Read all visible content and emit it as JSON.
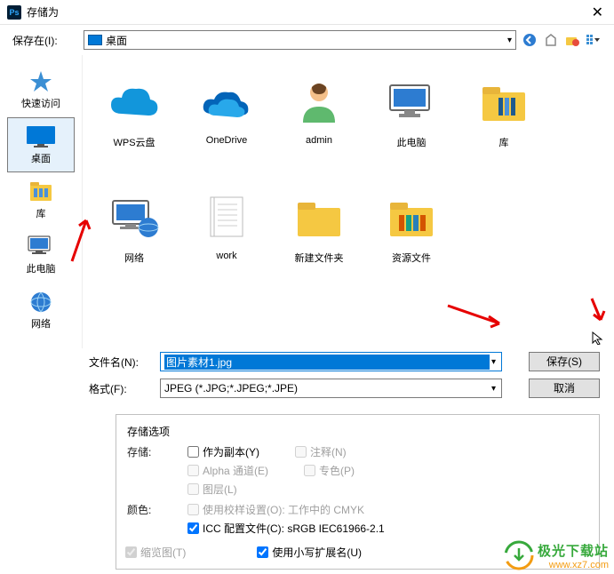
{
  "title": "存储为",
  "toprow": {
    "label": "保存在(I):",
    "location": "桌面"
  },
  "sidebar": [
    {
      "label": "快速访问"
    },
    {
      "label": "桌面"
    },
    {
      "label": "库"
    },
    {
      "label": "此电脑"
    },
    {
      "label": "网络"
    }
  ],
  "files": [
    {
      "label": "WPS云盘"
    },
    {
      "label": "OneDrive"
    },
    {
      "label": "admin"
    },
    {
      "label": "此电脑"
    },
    {
      "label": "库"
    },
    {
      "label": "网络"
    },
    {
      "label": "work"
    },
    {
      "label": "新建文件夹"
    },
    {
      "label": "资源文件"
    }
  ],
  "form": {
    "filename_label": "文件名(N):",
    "filename_value": "图片素材1.jpg",
    "format_label": "格式(F):",
    "format_value": "JPEG (*.JPG;*.JPEG;*.JPE)",
    "save_btn": "保存(S)",
    "cancel_btn": "取消"
  },
  "options": {
    "section": "存储选项",
    "store": "存储:",
    "as_copy": "作为副本(Y)",
    "annotations": "注释(N)",
    "alpha": "Alpha 通道(E)",
    "spot": "专色(P)",
    "layers": "图层(L)",
    "color": "颜色:",
    "proof": "使用校样设置(O): 工作中的 CMYK",
    "icc": "ICC 配置文件(C): sRGB IEC61966-2.1",
    "thumbnail": "缩览图(T)",
    "lowercase": "使用小写扩展名(U)"
  },
  "watermark": {
    "title": "极光下载站",
    "url": "www.xz7.com"
  }
}
